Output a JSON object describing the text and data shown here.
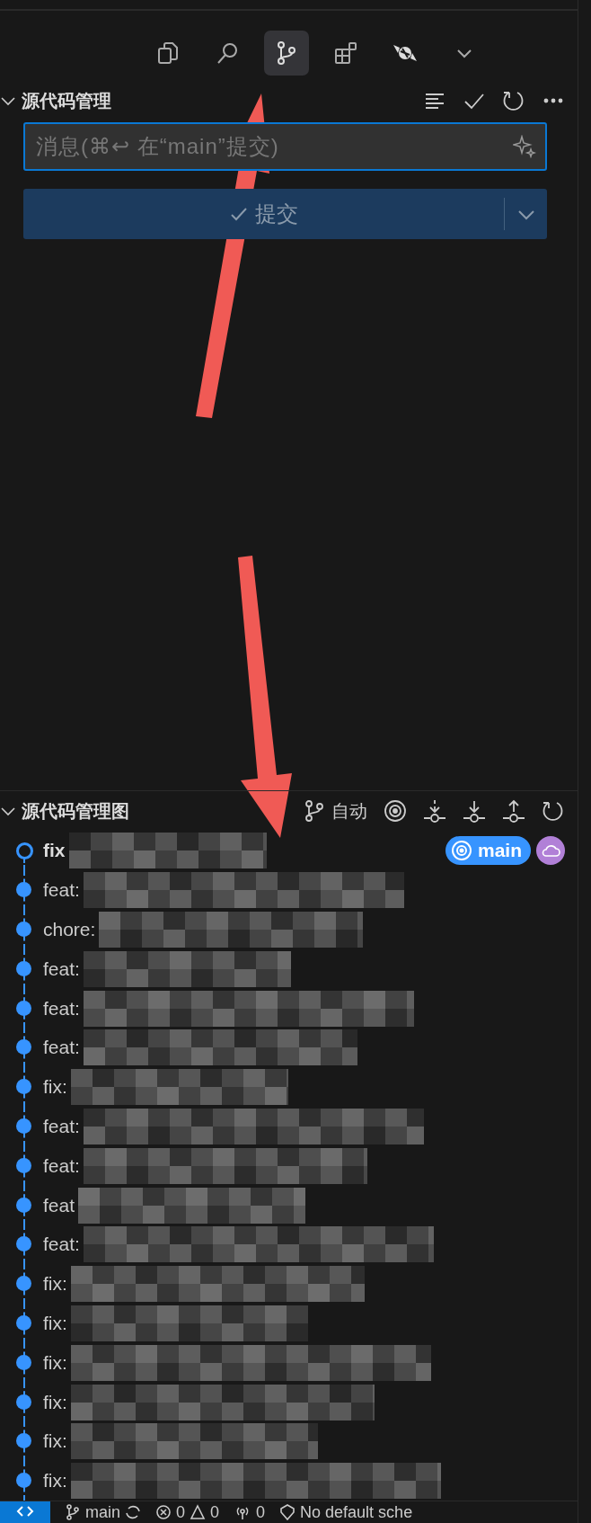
{
  "activity_bar": {
    "items": [
      {
        "kind": "explorer",
        "selected": false
      },
      {
        "kind": "search",
        "selected": false
      },
      {
        "kind": "scm",
        "selected": true
      },
      {
        "kind": "extensions",
        "selected": false
      },
      {
        "kind": "candy",
        "selected": false
      },
      {
        "kind": "more",
        "selected": false
      }
    ]
  },
  "scm": {
    "title": "源代码管理",
    "message_field": {
      "placeholder": "消息(⌘↩ 在“main”提交)"
    },
    "commit_button": {
      "label": "提交"
    }
  },
  "graph": {
    "title": "源代码管理图",
    "auto_label": "自动",
    "commits": [
      {
        "message": "fix",
        "current": true,
        "badges": [
          {
            "kind": "branch",
            "label": "main",
            "color": "#3794ff"
          },
          {
            "kind": "cloud",
            "color": "#b180d7"
          }
        ]
      },
      {
        "message": "feat:",
        "current": false
      },
      {
        "message": "chore:",
        "current": false
      },
      {
        "message": "feat:",
        "current": false
      },
      {
        "message": "feat:",
        "current": false
      },
      {
        "message": "feat:",
        "current": false
      },
      {
        "message": "fix:",
        "current": false
      },
      {
        "message": "feat:",
        "current": false
      },
      {
        "message": "feat:",
        "current": false
      },
      {
        "message": "feat",
        "current": false
      },
      {
        "message": "feat:",
        "current": false
      },
      {
        "message": "fix:",
        "current": false
      },
      {
        "message": "fix:",
        "current": false
      },
      {
        "message": "fix:",
        "current": false
      },
      {
        "message": "fix:",
        "current": false
      },
      {
        "message": "fix:",
        "current": false
      },
      {
        "message": "fix:",
        "current": false
      }
    ]
  },
  "status_bar": {
    "branch": "main",
    "errors": "0",
    "warnings": "0",
    "ports": "0",
    "profile": "No default sche"
  }
}
